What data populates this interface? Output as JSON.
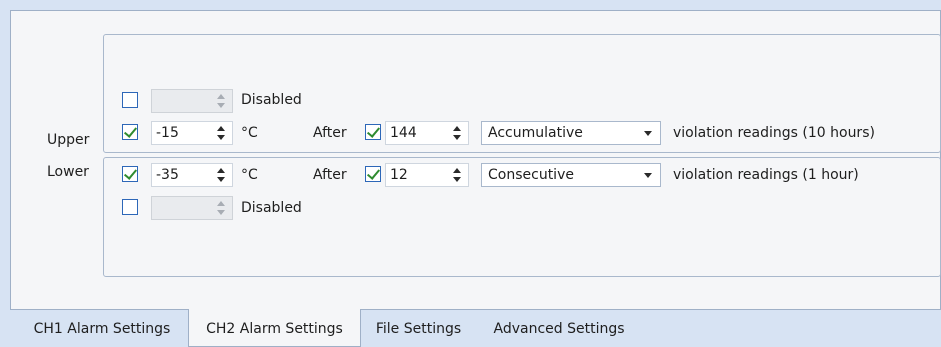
{
  "upper": {
    "label": "Upper",
    "disabled_row": {
      "checked": false,
      "value": "",
      "status_text": "Disabled"
    },
    "active_row": {
      "checked": true,
      "value": "-15",
      "unit": "°C",
      "after_label": "After",
      "after_checked": true,
      "after_value": "144",
      "mode": "Accumulative",
      "description": "violation readings (10 hours)"
    }
  },
  "lower": {
    "label": "Lower",
    "active_row": {
      "checked": true,
      "value": "-35",
      "unit": "°C",
      "after_label": "After",
      "after_checked": true,
      "after_value": "12",
      "mode": "Consecutive",
      "description": "violation readings (1 hour)"
    },
    "disabled_row": {
      "checked": false,
      "value": "",
      "status_text": "Disabled"
    }
  },
  "tabs": [
    {
      "label": "CH1 Alarm Settings",
      "active": false
    },
    {
      "label": "CH2 Alarm Settings",
      "active": true
    },
    {
      "label": "File Settings",
      "active": false
    },
    {
      "label": "Advanced Settings",
      "active": false
    }
  ]
}
